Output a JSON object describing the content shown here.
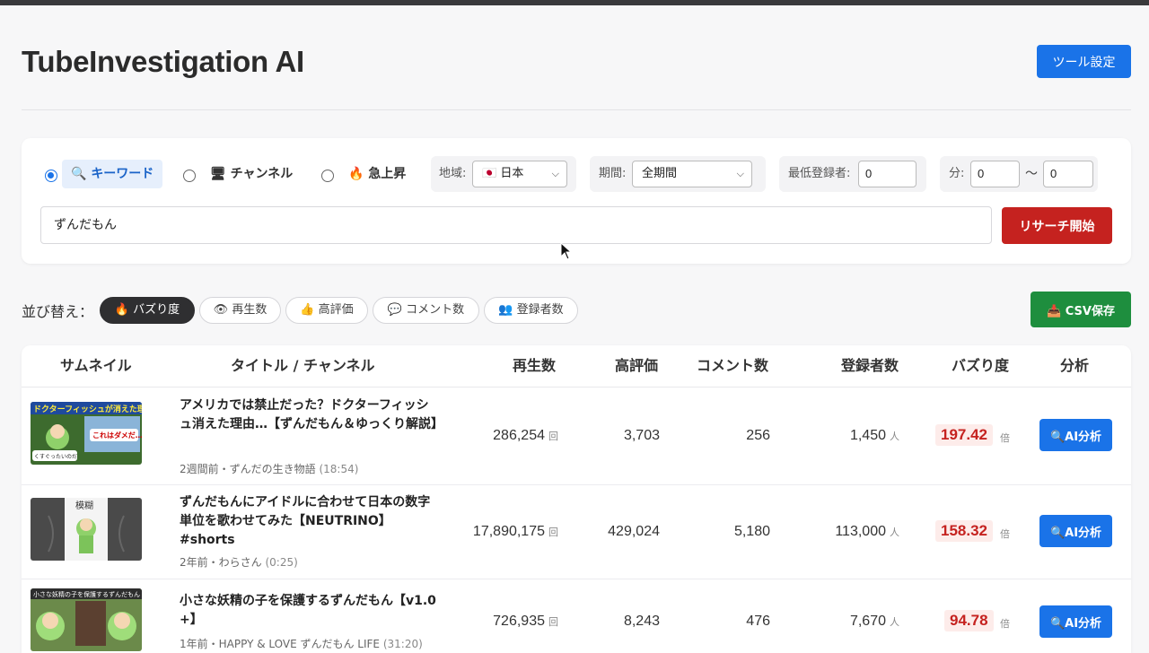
{
  "app": {
    "title": "TubeInvestigation AI",
    "settings_label": "ツール設定"
  },
  "search": {
    "modes": [
      {
        "icon": "🔍",
        "label": "キーワード",
        "selected": true
      },
      {
        "icon": "🖥",
        "label": "チャンネル",
        "selected": false
      },
      {
        "icon": "🔥",
        "label": "急上昇",
        "selected": false
      }
    ],
    "region": {
      "label": "地域:",
      "value": "日本",
      "flag": "🇯🇵"
    },
    "period": {
      "label": "期間:",
      "value": "全期間"
    },
    "min_subscribers": {
      "label": "最低登録者:",
      "value": "0"
    },
    "minutes": {
      "label": "分:",
      "from": "0",
      "separator": "〜",
      "to": "0"
    },
    "keyword": "ずんだもん",
    "submit_label": "リサーチ開始"
  },
  "sort": {
    "label": "並び替え：",
    "options": [
      {
        "icon": "🔥",
        "label": "バズり度",
        "active": true
      },
      {
        "icon": "👁",
        "label": "再生数",
        "active": false
      },
      {
        "icon": "👍",
        "label": "高評価",
        "active": false
      },
      {
        "icon": "💬",
        "label": "コメント数",
        "active": false
      },
      {
        "icon": "👥",
        "label": "登録者数",
        "active": false
      }
    ],
    "csv_label": "CSV保存",
    "csv_icon": "📥"
  },
  "table": {
    "headers": {
      "thumbnail": "サムネイル",
      "title": "タイトル / チャンネル",
      "views": "再生数",
      "likes": "高評価",
      "comments": "コメント数",
      "subscribers": "登録者数",
      "buzz": "バズり度",
      "analysis": "分析"
    },
    "units": {
      "views": "回",
      "subscribers": "人",
      "buzz": "倍"
    },
    "rows": [
      {
        "title": "アメリカでは禁止だった？ドクターフィッシュ消えた理由…【ずんだもん＆ゆっくり解説】",
        "meta": "2週間前・ずんだの生き物語",
        "duration": "(18:54)",
        "views": "286,254",
        "likes": "3,703",
        "comments": "256",
        "subscribers": "1,450",
        "buzz": "197.42",
        "button": "AI分析",
        "thumb_text": [
          "ドクターフィッシュが消えた理由",
          "これはダメだ…",
          "くすぐったいのだ"
        ]
      },
      {
        "title": "ずんだもんにアイドルに合わせて日本の数字単位を歌わせてみた【NEUTRINO】#shorts",
        "meta": "2年前・わらさん",
        "duration": "(0:25)",
        "views": "17,890,175",
        "likes": "429,024",
        "comments": "5,180",
        "subscribers": "113,000",
        "buzz": "158.32",
        "button": "AI分析",
        "thumb_text": [
          "模糊"
        ]
      },
      {
        "title": "小さな妖精の子を保護するずんだもん【v1.0 +】",
        "meta": "1年前・HAPPY & LOVE ずんだもん LIFE",
        "duration": "(31:20)",
        "views": "726,935",
        "likes": "8,243",
        "comments": "476",
        "subscribers": "7,670",
        "buzz": "94.78",
        "button": "AI分析",
        "thumb_text": [
          "小さな妖精の子を保護するずんだもん"
        ]
      }
    ]
  },
  "colors": {
    "primary": "#1a73e8",
    "danger": "#c5221f",
    "success": "#1e8e3e",
    "dark": "#2f2f31"
  }
}
